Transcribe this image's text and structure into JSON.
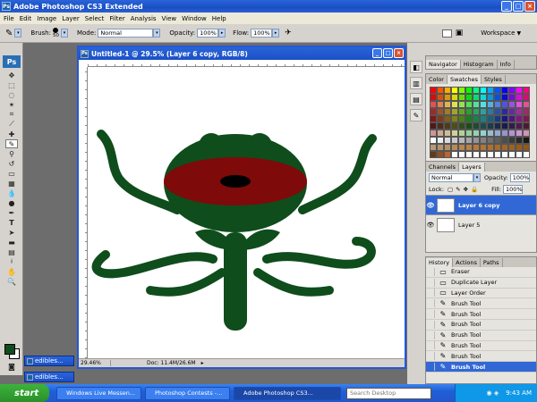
{
  "app": {
    "title": "Adobe Photoshop CS3 Extended"
  },
  "menu": [
    "File",
    "Edit",
    "Image",
    "Layer",
    "Select",
    "Filter",
    "Analysis",
    "View",
    "Window",
    "Help"
  ],
  "options": {
    "brush_label": "Brush:",
    "brush_size": "50",
    "mode_label": "Mode:",
    "mode_value": "Normal",
    "opacity_label": "Opacity:",
    "opacity_value": "100%",
    "flow_label": "Flow:",
    "flow_value": "100%",
    "workspace_label": "Workspace"
  },
  "tools_logo": "Ps",
  "document": {
    "title": "Untitled-1 @ 29.5% (Layer 6 copy, RGB/8)",
    "zoom": "29.46%",
    "doc_info": "Doc: 11.4M/26.6M"
  },
  "minimized_docs": [
    "edibles...",
    "edibles..."
  ],
  "panels": {
    "navigator_tabs": [
      "Navigator",
      "Histogram",
      "Info"
    ],
    "color_tabs": [
      "Color",
      "Swatches",
      "Styles"
    ],
    "layers_tabs": [
      "Channels",
      "Layers"
    ],
    "layers_blend": "Normal",
    "layers_opacity_label": "Opacity:",
    "layers_opacity": "100%",
    "layers_lock_label": "Lock:",
    "layers_fill_label": "Fill:",
    "layers_fill": "100%",
    "layers": [
      "Layer 6 copy",
      "Layer 5"
    ],
    "history_tabs": [
      "History",
      "Actions",
      "Paths"
    ],
    "history": [
      "Eraser",
      "Duplicate Layer",
      "Layer Order",
      "Brush Tool",
      "Brush Tool",
      "Brush Tool",
      "Brush Tool",
      "Brush Tool",
      "Brush Tool",
      "Brush Tool"
    ]
  },
  "taskbar": {
    "start": "start",
    "items": [
      "Windows Live Messen...",
      "Photoshop Contests -...",
      "Adobe Photoshop CS3..."
    ],
    "search_placeholder": "Search Desktop",
    "time": "9:43 AM"
  },
  "colors": {
    "dark_green": "#0f4d1c",
    "dark_red": "#7f0a0a",
    "xp_blue": "#2458d8"
  }
}
